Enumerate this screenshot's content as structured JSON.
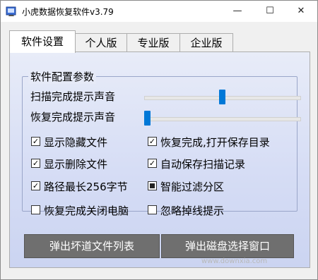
{
  "window": {
    "title": "小虎数据恢复软件v3.79",
    "controls": {
      "minimize": "—",
      "maximize": "☐",
      "close": "✕"
    }
  },
  "tabs": [
    {
      "label": "软件设置",
      "active": true
    },
    {
      "label": "个人版",
      "active": false
    },
    {
      "label": "专业版",
      "active": false
    },
    {
      "label": "企业版",
      "active": false
    }
  ],
  "group": {
    "title": "软件配置参数",
    "sliders": [
      {
        "label": "扫描完成提示声音",
        "value": 0.5
      },
      {
        "label": "恢复完成提示声音",
        "value": 0.0
      }
    ],
    "checkboxes": [
      {
        "label": "显示隐藏文件",
        "state": "checked"
      },
      {
        "label": "恢复完成,打开保存目录",
        "state": "checked"
      },
      {
        "label": "显示删除文件",
        "state": "checked"
      },
      {
        "label": "自动保存扫描记录",
        "state": "checked"
      },
      {
        "label": "路径最长256字节",
        "state": "checked"
      },
      {
        "label": "智能过滤分区",
        "state": "mixed"
      },
      {
        "label": "恢复完成关闭电脑",
        "state": "unchecked"
      },
      {
        "label": "忽略掉线提示",
        "state": "unchecked"
      }
    ]
  },
  "buttons": {
    "bad_sector_list": "弹出坏道文件列表",
    "disk_select_window": "弹出磁盘选择窗口"
  },
  "watermark": "www.downxia.com",
  "colors": {
    "accent": "#0078d7",
    "button": "#6f6f6f"
  }
}
